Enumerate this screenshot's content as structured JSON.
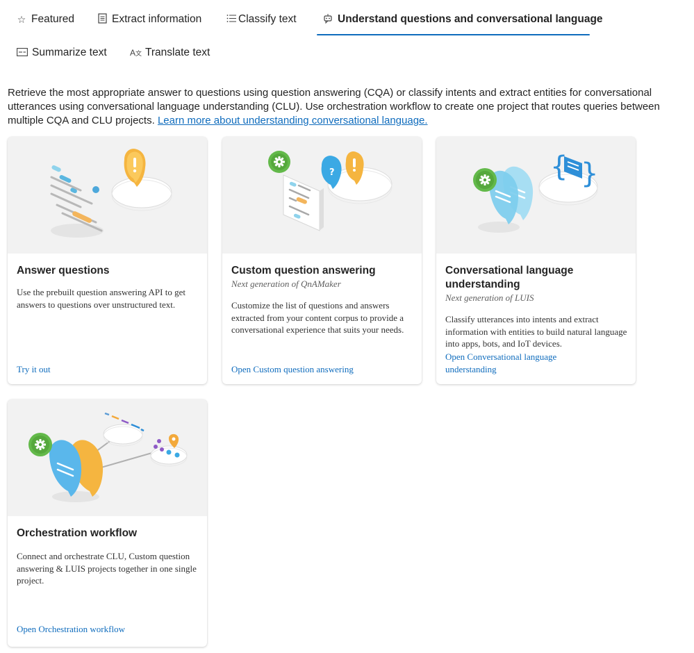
{
  "tabs": [
    {
      "label": "Featured",
      "icon": "star-icon"
    },
    {
      "label": "Extract information",
      "icon": "document-icon"
    },
    {
      "label": "Classify text",
      "icon": "list-icon"
    },
    {
      "label": "Understand questions and conversational language",
      "icon": "bot-icon",
      "active": true
    },
    {
      "label": "Summarize text",
      "icon": "summary-icon"
    },
    {
      "label": "Translate text",
      "icon": "translate-icon"
    }
  ],
  "intro": {
    "text": "Retrieve the most appropriate answer to questions using question answering (CQA) or classify intents and extract entities for conversational utterances using conversational language understanding (CLU). Use orchestration workflow to create one project that routes queries between multiple CQA and CLU projects. ",
    "link": "Learn more about understanding conversational language."
  },
  "cards": [
    {
      "title": "Answer questions",
      "subtitle": "",
      "description": "Use the prebuilt question answering API to get answers to questions over unstructured text.",
      "link": "Try it out"
    },
    {
      "title": "Custom question answering",
      "subtitle": "Next generation of QnAMaker",
      "description": "Customize the list of questions and answers extracted from your content corpus to provide a conversational experience that suits your needs.",
      "link": "Open Custom question answering"
    },
    {
      "title": "Conversational language understanding",
      "subtitle": "Next generation of LUIS",
      "description": "Classify utterances into intents and extract information with entities to build natural language into apps, bots, and IoT devices.",
      "link": "Open Conversational language understanding"
    },
    {
      "title": "Orchestration workflow",
      "subtitle": "",
      "description": "Connect and orchestrate CLU, Custom question answering & LUIS projects together in one single project.",
      "link": "Open Orchestration workflow"
    }
  ],
  "colors": {
    "accent": "#0f6cbd",
    "card_image_bg": "#f2f2f2"
  }
}
